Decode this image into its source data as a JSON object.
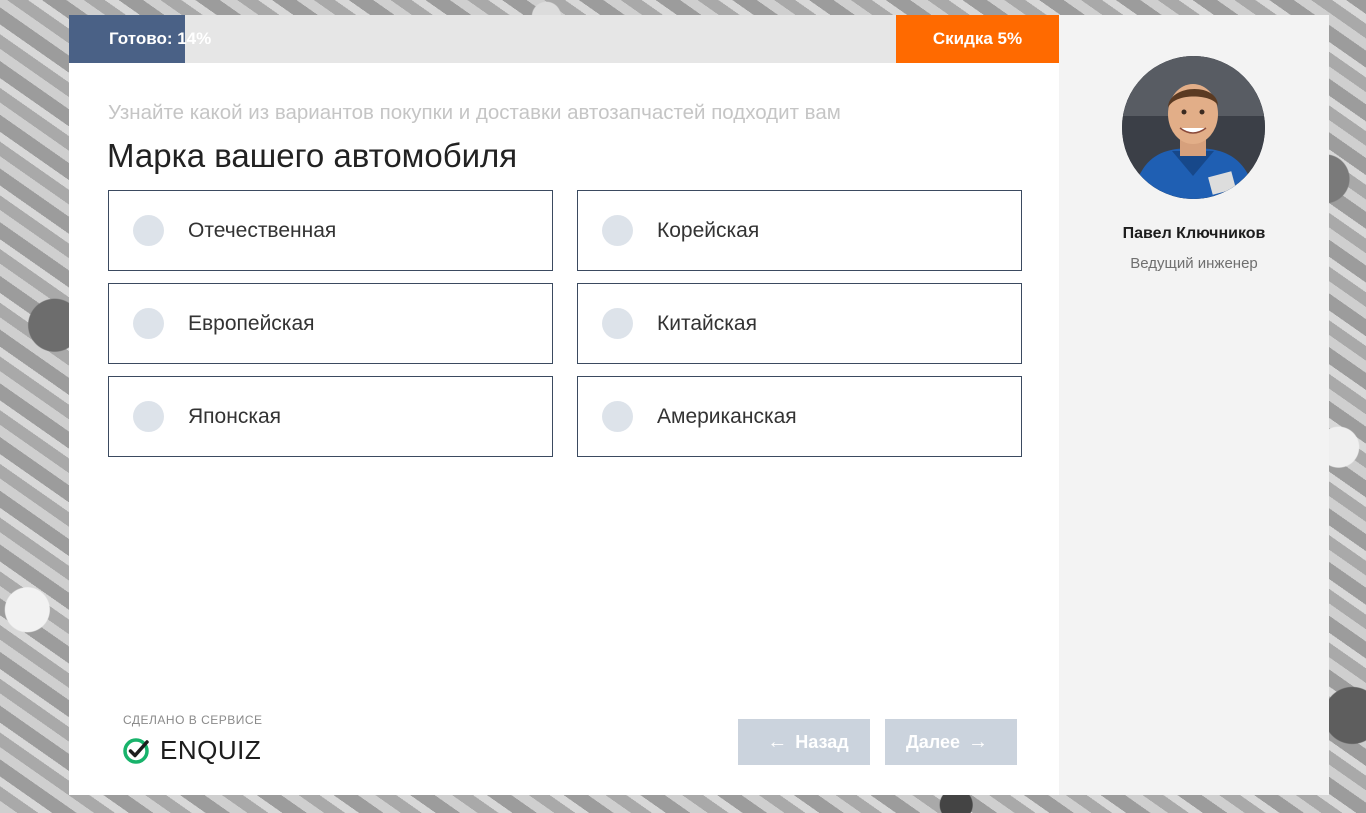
{
  "progress": {
    "label": "Готово: 14%",
    "value": 0.14,
    "color": "#4a6186"
  },
  "discount": {
    "label": "Скидка 5%",
    "color": "#ff6a00"
  },
  "quiz": {
    "subtitle": "Узнайте какой из вариантов покупки и доставки автозапчастей подходит вам",
    "question": "Марка вашего автомобиля",
    "options": [
      "Отечественная",
      "Корейская",
      "Европейская",
      "Китайская",
      "Японская",
      "Американская"
    ]
  },
  "footer": {
    "made_with": "СДЕЛАНО В СЕРВИСЕ",
    "brand": "ENQUIZ",
    "brand_icon": "check-circle-icon",
    "back_label": "Назад",
    "next_label": "Далее",
    "back_icon": "arrow-left-icon",
    "next_icon": "arrow-right-icon"
  },
  "consultant": {
    "name": "Павел Ключников",
    "role": "Ведущий инженер"
  }
}
